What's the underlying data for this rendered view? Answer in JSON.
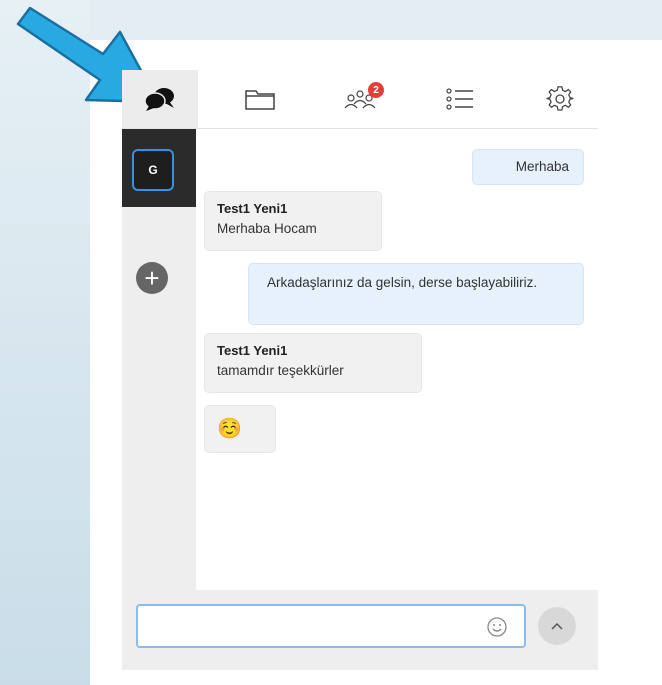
{
  "toolbar": {
    "tabs": [
      {
        "icon": "chat-icon",
        "active": true
      },
      {
        "icon": "folder-icon"
      },
      {
        "icon": "users-icon",
        "badge": "2"
      },
      {
        "icon": "list-icon"
      },
      {
        "icon": "gear-icon"
      }
    ]
  },
  "sidebar": {
    "rooms": [
      {
        "label": "G",
        "active": true
      }
    ],
    "add_icon": "plus-icon"
  },
  "messages": [
    {
      "direction": "outgoing",
      "text": "Merhaba"
    },
    {
      "direction": "incoming",
      "sender": "Test1 Yeni1",
      "text": "Merhaba Hocam"
    },
    {
      "direction": "outgoing",
      "text": "Arkadaşlarınız da gelsin, derse başlayabiliriz."
    },
    {
      "direction": "incoming",
      "sender": "Test1 Yeni1",
      "text": "tamamdır teşekkürler"
    },
    {
      "direction": "incoming",
      "text": "☺️"
    }
  ],
  "composer": {
    "value": "",
    "emoji_icon": "smiley-icon",
    "send_icon": "chevron-up-icon"
  },
  "colors": {
    "accent": "#3a8fe0",
    "badge": "#e0403a",
    "arrow": "#29a9e1",
    "outgoing_bubble": "#e6f1fc",
    "incoming_bubble": "#f1f1f1"
  }
}
